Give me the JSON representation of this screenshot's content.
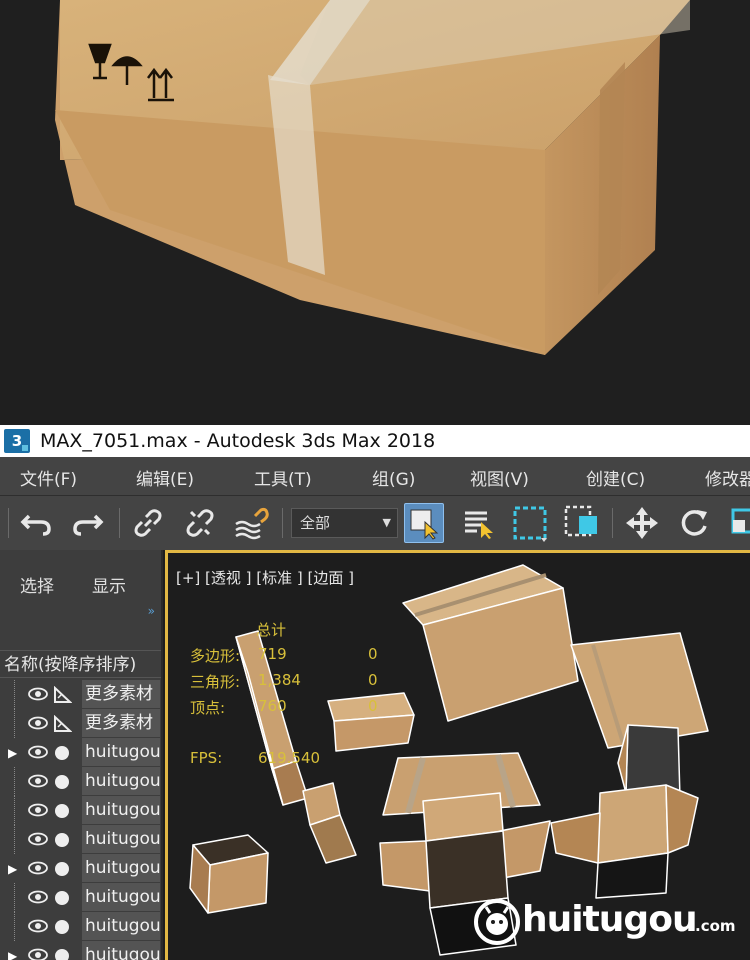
{
  "window": {
    "app_icon_label": "3",
    "title": "MAX_7051.max - Autodesk 3ds Max 2018"
  },
  "menu": {
    "items": [
      "文件(F)",
      "编辑(E)",
      "工具(T)",
      "组(G)",
      "视图(V)",
      "创建(C)",
      "修改器"
    ]
  },
  "toolbar": {
    "selection_filter": "全部",
    "icons": [
      "undo-icon",
      "redo-icon",
      "link-icon",
      "unlink-icon",
      "bind-space-warp-icon",
      "select-object-icon",
      "select-by-name-icon",
      "rectangular-selection-icon",
      "window-crossing-icon",
      "move-icon",
      "rotate-icon",
      "scale-icon"
    ]
  },
  "scene_explorer": {
    "tabs": [
      "选择",
      "显示"
    ],
    "more_label": "»",
    "column_header": "名称(按降序排序)",
    "rows": [
      {
        "label": "更多素材",
        "expandable": false,
        "icon": "shape"
      },
      {
        "label": "更多素材",
        "expandable": false,
        "icon": "shape"
      },
      {
        "label": "huitugou",
        "expandable": true,
        "icon": "geometry"
      },
      {
        "label": "huitugou",
        "expandable": false,
        "icon": "geometry"
      },
      {
        "label": "huitugou",
        "expandable": false,
        "icon": "geometry"
      },
      {
        "label": "huitugou",
        "expandable": false,
        "icon": "geometry"
      },
      {
        "label": "huitugou",
        "expandable": true,
        "icon": "geometry"
      },
      {
        "label": "huitugou",
        "expandable": false,
        "icon": "geometry"
      },
      {
        "label": "huitugou",
        "expandable": false,
        "icon": "geometry"
      },
      {
        "label": "huitugou",
        "expandable": true,
        "icon": "geometry"
      }
    ]
  },
  "viewport": {
    "label": "[+] [透视 ] [标准 ] [边面 ]",
    "stats": {
      "header": "总计",
      "polygons_label": "多边形:",
      "polygons_value": "719",
      "polygons_selected": "0",
      "triangles_label": "三角形:",
      "triangles_value": "1,384",
      "triangles_selected": "0",
      "vertices_label": "顶点:",
      "vertices_value": "760",
      "vertices_selected": "0",
      "fps_label": "FPS:",
      "fps_value": "619.540"
    },
    "watermark": {
      "text": "huitugou",
      "suffix": ".com"
    }
  },
  "render_preview": {
    "box_color": "#d4a866",
    "tape_color": "#e8e0d0",
    "background": "#1f1f1f",
    "handling_symbols": [
      "fragile-glass-icon",
      "keep-dry-umbrella-icon",
      "this-way-up-icon"
    ]
  },
  "colors": {
    "ui_background": "#444444",
    "viewport_border": "#e2b844",
    "stats_text": "#d8c03a",
    "active_tool": "#5b8dbe",
    "cardboard": "#c8a170"
  }
}
